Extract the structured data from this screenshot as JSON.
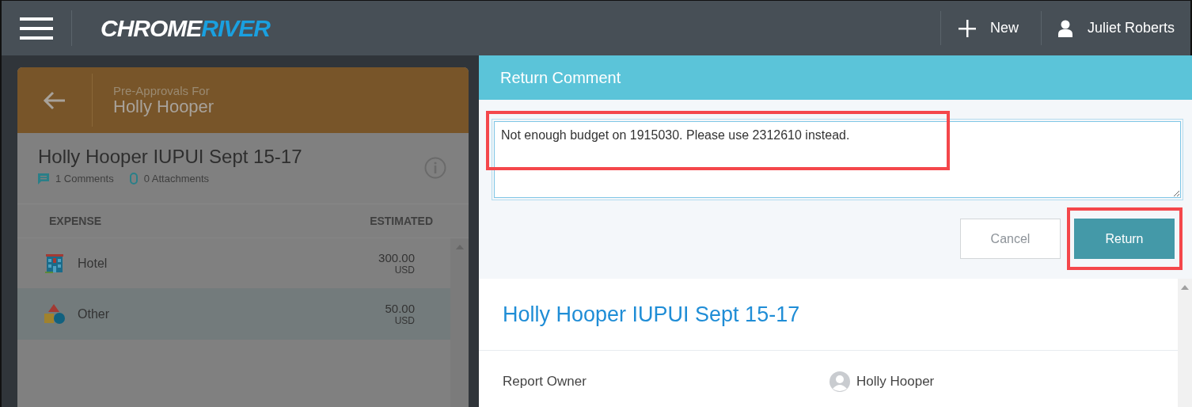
{
  "header": {
    "logo": [
      "CHROME",
      "RIVER"
    ],
    "new_label": "New",
    "user_name": "Juliet Roberts"
  },
  "left_panel": {
    "subtitle": "Pre-Approvals For",
    "name": "Holly Hooper",
    "report_title": "Holly Hooper IUPUI Sept 15-17",
    "comments": "1 Comments",
    "attachments": "0 Attachments",
    "columns": [
      "EXPENSE",
      "ESTIMATED"
    ],
    "rows": [
      {
        "kind": "hotel",
        "label": "Hotel",
        "amount": "300.00",
        "currency": "USD",
        "selected": false
      },
      {
        "kind": "other",
        "label": "Other",
        "amount": "50.00",
        "currency": "USD",
        "selected": true
      }
    ]
  },
  "return_dialog": {
    "title": "Return Comment",
    "comment": "Not enough budget on 1915030. Please use 2312610 instead.",
    "comment_highlighted": true,
    "buttons": [
      {
        "kind": "cancel",
        "label": "Cancel",
        "highlighted": false
      },
      {
        "kind": "primary",
        "label": "Return",
        "highlighted": true
      }
    ]
  },
  "report": {
    "title": "Holly Hooper IUPUI Sept 15-17",
    "fields": [
      {
        "label": "Report Owner",
        "value": "Holly Hooper"
      }
    ]
  }
}
